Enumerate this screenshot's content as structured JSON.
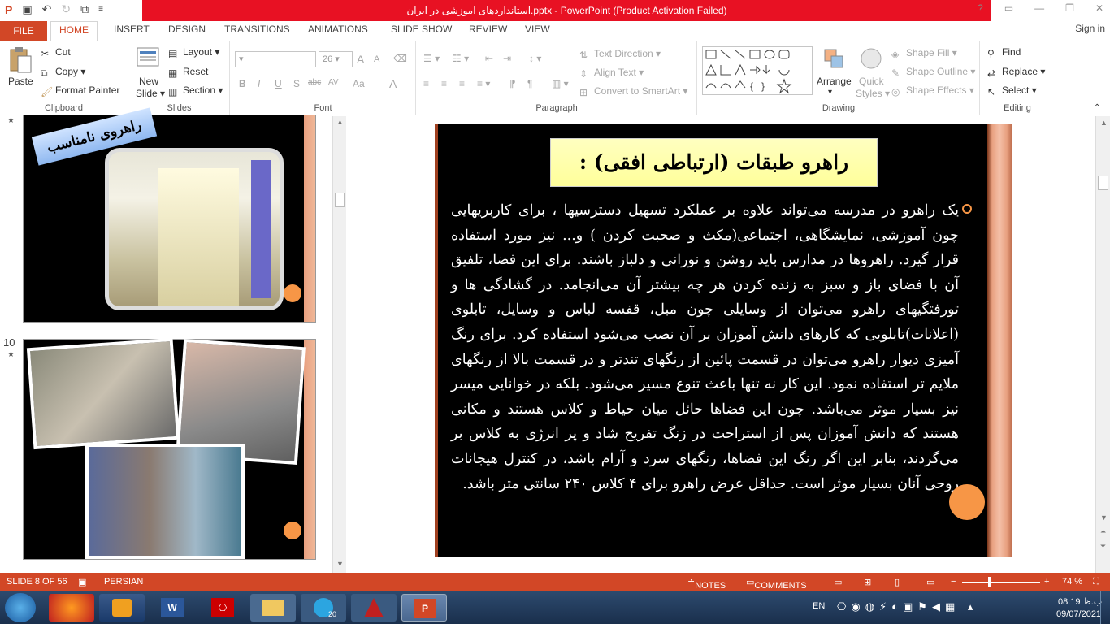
{
  "window": {
    "title": "استانداردهای اموزشی در ایران.pptx - PowerPoint (Product Activation Failed)",
    "help": "?",
    "restore": "▭",
    "minimize": "—",
    "maximize": "❐",
    "close": "✕"
  },
  "qat": {
    "save": "💾",
    "undo": "↶",
    "redo": "↻",
    "customize": "≡"
  },
  "tabs": {
    "file": "FILE",
    "home": "HOME",
    "insert": "INSERT",
    "design": "DESIGN",
    "transitions": "TRANSITIONS",
    "animations": "ANIMATIONS",
    "slideshow": "SLIDE SHOW",
    "review": "REVIEW",
    "view": "VIEW",
    "signin": "Sign in"
  },
  "ribbon": {
    "clipboard": {
      "label": "Clipboard",
      "paste": "Paste",
      "cut": "Cut",
      "copy": "Copy",
      "format_painter": "Format Painter"
    },
    "slides": {
      "label": "Slides",
      "new_slide": "New",
      "new_slide2": "Slide",
      "layout": "Layout",
      "reset": "Reset",
      "section": "Section"
    },
    "font": {
      "label": "Font",
      "size": "26",
      "bold": "B",
      "italic": "I",
      "underline": "U",
      "shadow": "S",
      "strike": "abc",
      "spacing": "AV",
      "case": "Aa",
      "color": "A",
      "grow": "A",
      "shrink": "A"
    },
    "paragraph": {
      "label": "Paragraph",
      "text_direction": "Text Direction",
      "align_text": "Align Text",
      "smartart": "Convert to SmartArt"
    },
    "drawing": {
      "label": "Drawing",
      "arrange": "Arrange",
      "quick_styles": "Quick",
      "quick_styles2": "Styles",
      "shape_fill": "Shape Fill",
      "shape_outline": "Shape Outline",
      "shape_effects": "Shape Effects"
    },
    "editing": {
      "label": "Editing",
      "find": "Find",
      "replace": "Replace",
      "select": "Select"
    }
  },
  "thumbs": {
    "slide9_label": "راهروی نامناسب",
    "slide10_number": "10",
    "star": "★"
  },
  "slide": {
    "title": "راهرو طبقات (ارتباطی افقی) :",
    "body": "یک راهرو در مدرسه می‌تواند علاوه بر عملکرد تسهیل دسترسیها ، برای کاربریهایی چون آموزشی، نمایشگاهی، اجتماعی(مکث و صحبت کردن ) و... نیز مورد استفاده قرار گیرد. راهروها در مدارس باید روشن و نورانی و دلباز باشند. برای این فضا، تلفیق آن با فضای باز و سبز به زنده کردن هر چه بیشتر آن می‌انجامد. در گشادگی ها و تورفتگیهای راهرو می‌توان از وسایلی چون مبل، قفسه لباس و وسایل، تابلوی (اعلانات)تابلویی که کارهای دانش آموزان بر آن نصب می‌شود استفاده کرد. برای رنگ آمیزی دیوار راهرو می‌توان در قسمت پائین از رنگهای تندتر و در قسمت بالا از رنگهای ملایم تر استفاده نمود. این کار نه تنها باعث تنوع مسیر می‌شود. بلکه در خوانایی میسر نیز بسیار موثر می‌باشد. چون این فضاها حائل میان حیاط و کلاس هستند و مکانی هستند که دانش آموزان پس از استراحت در زنگ تفریح شاد و پر انرژی به کلاس بر می‌گردند، بنابر این اگر رنگ این فضاها، رنگهای سرد و آرام باشد، در کنترل هیجانات روحی آنان بسیار موثر است. حداقل عرض راهرو برای ۴ کلاس ۲۴۰ سانتی متر باشد."
  },
  "status": {
    "slide": "SLIDE 8 OF 56",
    "language": "PERSIAN",
    "notes": "NOTES",
    "comments": "COMMENTS",
    "zoom": "74 %",
    "minus": "−",
    "plus": "+"
  },
  "tray": {
    "lang": "EN",
    "time": "08:19 ب.ظ",
    "date": "09/07/2021",
    "telegram_badge": "20"
  },
  "colors": {
    "accent": "#d24726",
    "title_red": "#e81123",
    "slide_bg": "#000000",
    "bullet": "#f79646"
  }
}
